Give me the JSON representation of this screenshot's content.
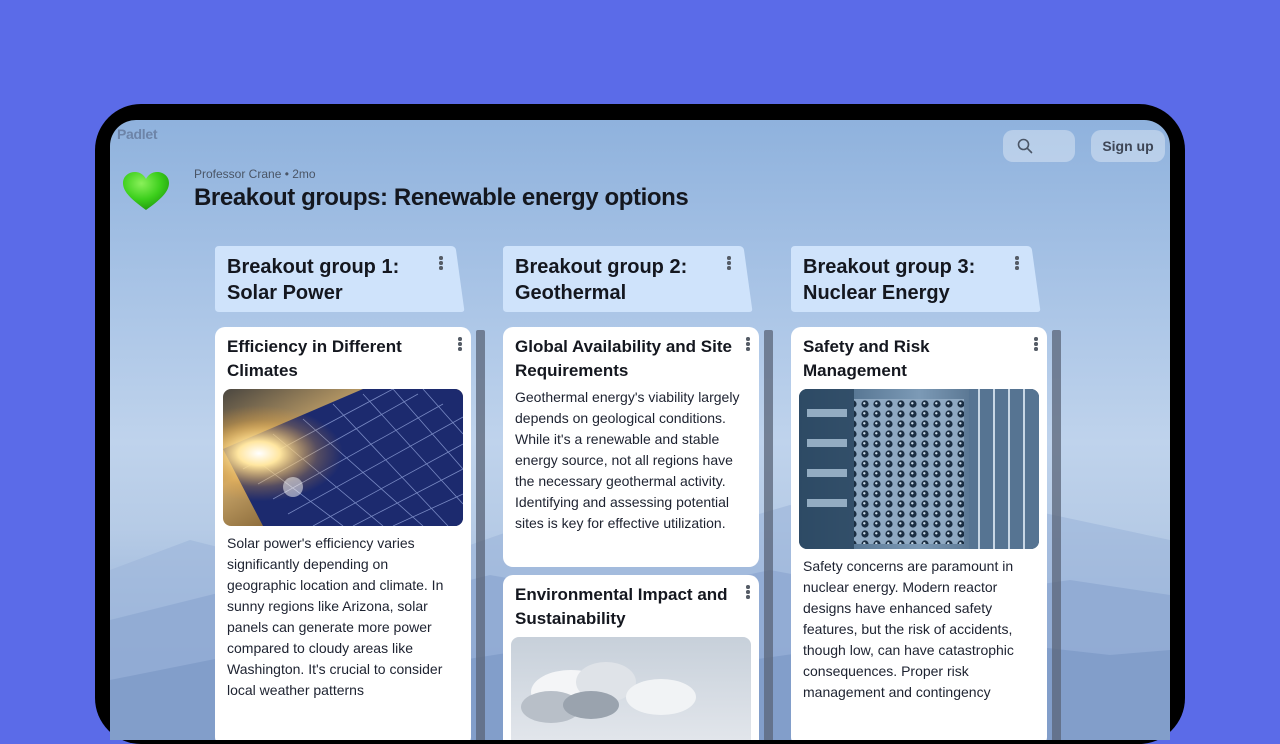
{
  "app": {
    "logo": "Padlet"
  },
  "header": {
    "search_icon": "search-icon",
    "signup_label": "Sign up",
    "author_meta": "Professor Crane • 2mo",
    "board_title": "Breakout groups: Renewable energy options",
    "board_icon": "green-heart-icon"
  },
  "columns": [
    {
      "title": "Breakout group 1: Solar Power",
      "posts": [
        {
          "title": "Efficiency in Different Climates",
          "image": "solar-panels-photo",
          "body": "Solar power's efficiency varies significantly depending on geographic location and climate. In sunny regions like Arizona, solar panels can generate more power compared to cloudy areas like Washington. It's crucial to consider local weather patterns"
        }
      ]
    },
    {
      "title": "Breakout group 2: Geothermal",
      "posts": [
        {
          "title": "Global Availability and Site Requirements",
          "body": "Geothermal energy's viability largely depends on geological conditions. While it's a renewable and stable energy source, not all regions have the necessary geothermal activity. Identifying and assessing potential sites is key for effective utilization."
        },
        {
          "title": "Environmental Impact and Sustainability",
          "image": "steam-plant-photo"
        }
      ]
    },
    {
      "title": "Breakout group 3: Nuclear Energy",
      "posts": [
        {
          "title": "Safety and Risk Management",
          "image": "nuclear-fuel-rods-photo",
          "body": "Safety concerns are paramount in nuclear energy. Modern reactor designs have enhanced safety features, but the risk of accidents, though low, can have catastrophic consequences. Proper risk management and contingency"
        }
      ]
    }
  ],
  "colors": {
    "page_background": "#5b6be8",
    "device_frame": "#000000",
    "column_header_bg": "#cfe3fb",
    "card_bg": "#ffffff",
    "heart": "#3ccf1c"
  }
}
